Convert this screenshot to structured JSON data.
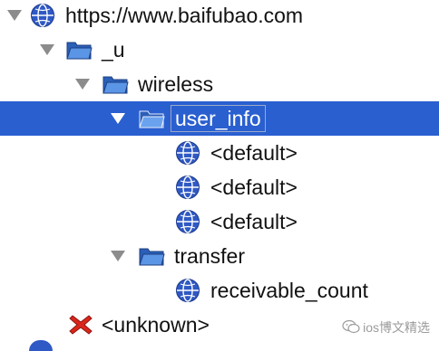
{
  "tree": {
    "rows": [
      {
        "label": "https://www.baifubao.com",
        "icon": "globe-icon",
        "expanded": true,
        "selected": false
      },
      {
        "label": "_u",
        "icon": "folder-icon",
        "expanded": true,
        "selected": false
      },
      {
        "label": "wireless",
        "icon": "folder-icon",
        "expanded": true,
        "selected": false
      },
      {
        "label": "user_info",
        "icon": "folder-icon",
        "expanded": true,
        "selected": true
      },
      {
        "label": "<default>",
        "icon": "globe-icon",
        "selected": false
      },
      {
        "label": "<default>",
        "icon": "globe-icon",
        "selected": false
      },
      {
        "label": "<default>",
        "icon": "globe-icon",
        "selected": false
      },
      {
        "label": "transfer",
        "icon": "folder-icon",
        "expanded": true,
        "selected": false
      },
      {
        "label": "receivable_count",
        "icon": "globe-icon",
        "selected": false
      },
      {
        "label": "<unknown>",
        "icon": "error-x-icon",
        "selected": false
      }
    ]
  },
  "watermark": {
    "text": "ios博文精选"
  },
  "colors": {
    "selection": "#2a5fd0",
    "folder": "#3f78d6",
    "globe": "#2f59c4",
    "error": "#d9261c",
    "disclosure": "#8c8c8c"
  }
}
